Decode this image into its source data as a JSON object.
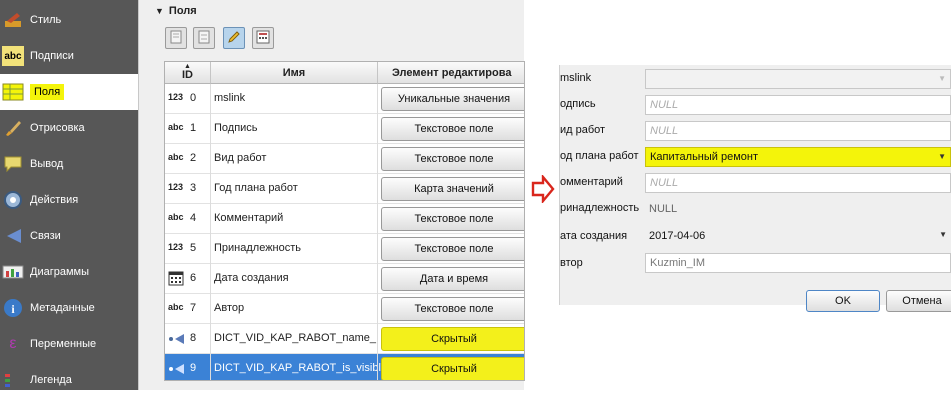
{
  "sidebar": {
    "items": [
      {
        "label": "Стиль",
        "icon": "brush-icon"
      },
      {
        "label": "Подписи",
        "icon": "abc-icon"
      },
      {
        "label": "Поля",
        "icon": "table-icon"
      },
      {
        "label": "Отрисовка",
        "icon": "paint-brush-icon"
      },
      {
        "label": "Вывод",
        "icon": "speech-bubble-icon"
      },
      {
        "label": "Действия",
        "icon": "gear-icon"
      },
      {
        "label": "Связи",
        "icon": "join-arrow-icon"
      },
      {
        "label": "Диаграммы",
        "icon": "diagram-icon"
      },
      {
        "label": "Метаданные",
        "icon": "info-icon"
      },
      {
        "label": "Переменные",
        "icon": "variable-icon"
      },
      {
        "label": "Легенда",
        "icon": "legend-icon"
      }
    ],
    "active_index": 2
  },
  "fields_panel": {
    "section_title": "Поля",
    "toolbar": [
      "new-field-icon",
      "delete-field-icon",
      "edit-mode-icon",
      "calculator-icon"
    ],
    "columns": {
      "id": "ID",
      "name": "Имя",
      "editor": "Элемент редактирова"
    },
    "rows": [
      {
        "type": "123",
        "id": "0",
        "name": "mslink",
        "editor": "Уникальные значения"
      },
      {
        "type": "abc",
        "id": "1",
        "name": "Подпись",
        "editor": "Текстовое поле"
      },
      {
        "type": "abc",
        "id": "2",
        "name": "Вид работ",
        "editor": "Текстовое поле"
      },
      {
        "type": "123",
        "id": "3",
        "name": "Год плана работ",
        "editor": "Карта значений"
      },
      {
        "type": "abc",
        "id": "4",
        "name": "Комментарий",
        "editor": "Текстовое поле"
      },
      {
        "type": "123",
        "id": "5",
        "name": "Принадлежность",
        "editor": "Текстовое поле"
      },
      {
        "type": "calendar",
        "id": "6",
        "name": "Дата создания",
        "editor": "Дата и время"
      },
      {
        "type": "abc",
        "id": "7",
        "name": "Автор",
        "editor": "Текстовое поле"
      },
      {
        "type": "join",
        "id": "8",
        "name": "DICT_VID_KAP_RABOT_name_",
        "editor": "Скрытый"
      },
      {
        "type": "join",
        "id": "9",
        "name": "DICT_VID_KAP_RABOT_is_visible",
        "editor": "Скрытый"
      }
    ]
  },
  "form": {
    "fields": [
      {
        "label": "mslink",
        "value": "",
        "style": "dropdown-empty"
      },
      {
        "label": "одпись",
        "value": "NULL",
        "style": "italic"
      },
      {
        "label": "ид работ",
        "value": "NULL",
        "style": "italic"
      },
      {
        "label": "од плана работ",
        "value": "Капитальный ремонт",
        "style": "highlight-dropdown"
      },
      {
        "label": "омментарий",
        "value": "NULL",
        "style": "italic"
      },
      {
        "label": "ринадлежность",
        "value": "NULL",
        "style": "plain"
      },
      {
        "label": "ата создания",
        "value": "2017-04-06",
        "style": "date-dropdown"
      },
      {
        "label": "втор",
        "value": "Kuzmin_IM",
        "style": "plain-box"
      }
    ],
    "ok_label": "OK",
    "cancel_label": "Отмена"
  },
  "colors": {
    "sidebar_bg": "#575757",
    "highlight": "#f4f40a",
    "selection": "#3b82d6",
    "arrow": "#d9261c"
  }
}
